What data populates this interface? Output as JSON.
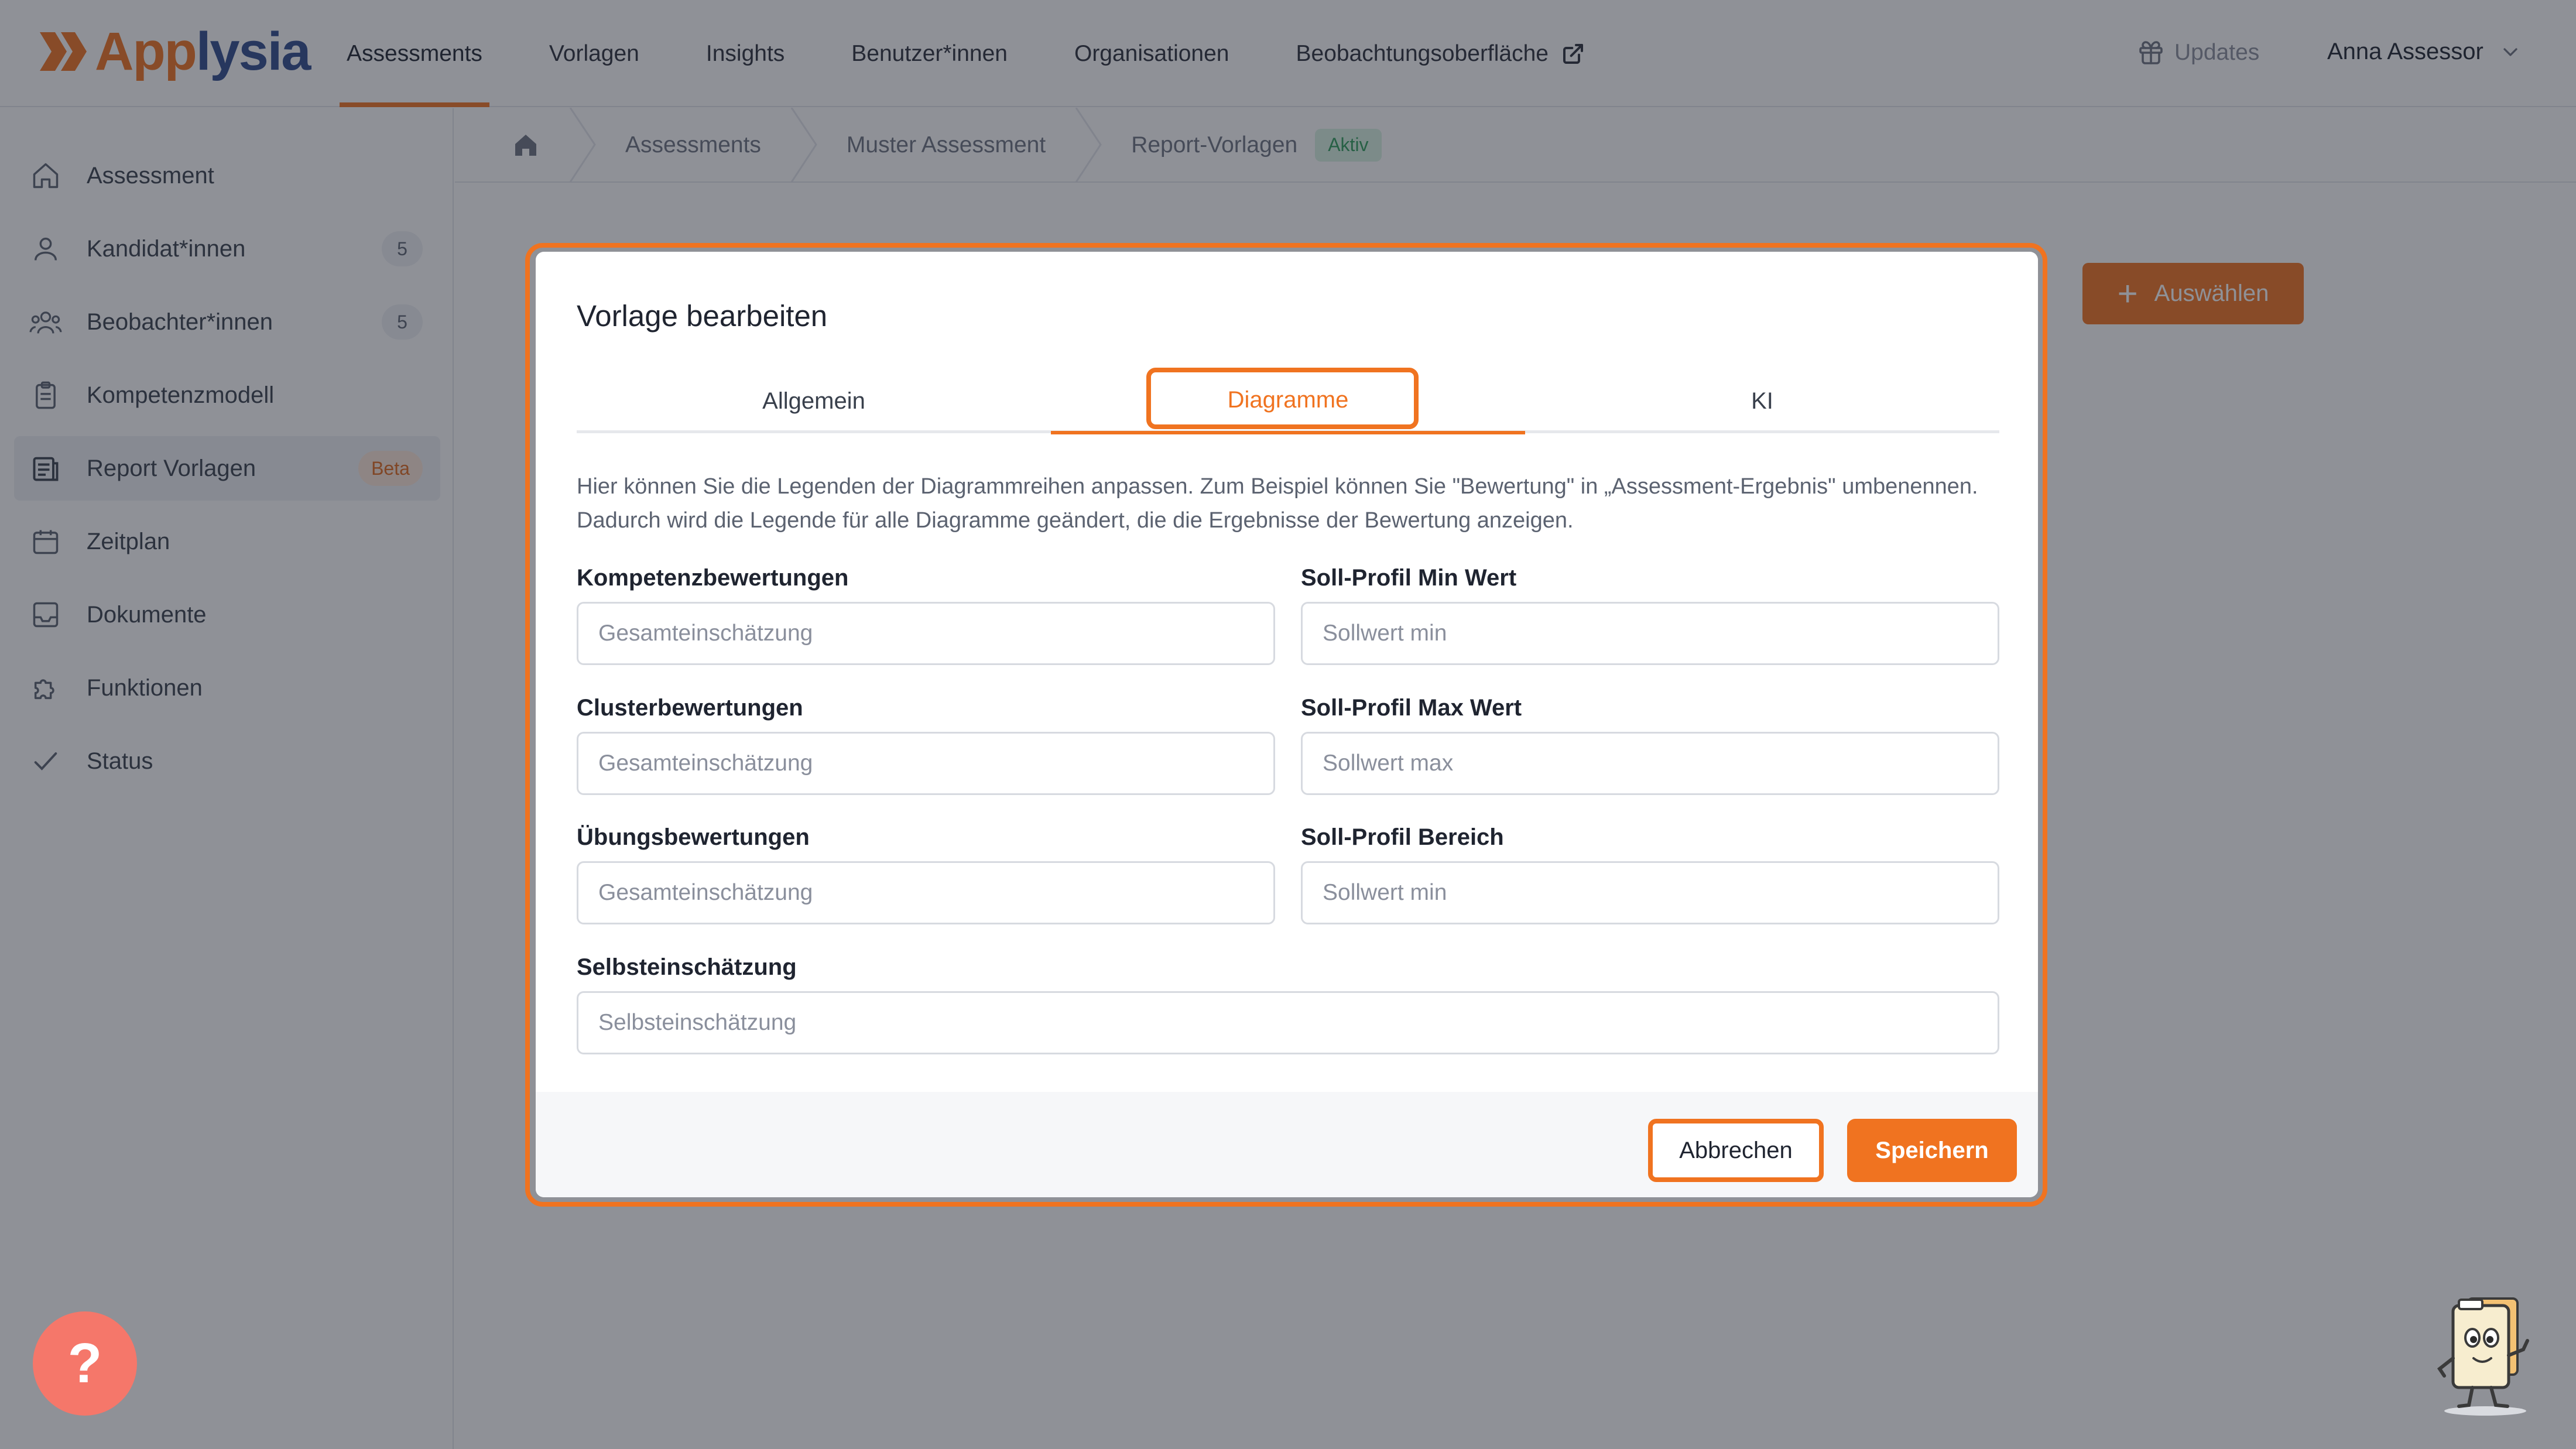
{
  "app": {
    "logo_text_a": "App",
    "logo_text_b": "lysia",
    "brand_color": "#f07320",
    "brand_color_secondary": "#2f4a8c"
  },
  "nav": {
    "items": [
      {
        "label": "Assessments",
        "active": true
      },
      {
        "label": "Vorlagen"
      },
      {
        "label": "Insights"
      },
      {
        "label": "Benutzer*innen"
      },
      {
        "label": "Organisationen"
      },
      {
        "label": "Beobachtungsoberfläche",
        "icon": "external-link-icon"
      }
    ],
    "updates_label": "Updates",
    "user_name": "Anna Assessor"
  },
  "sidebar": {
    "items": [
      {
        "label": "Assessment",
        "icon": "home-icon"
      },
      {
        "label": "Kandidat*innen",
        "icon": "user-icon",
        "badge": "5"
      },
      {
        "label": "Beobachter*innen",
        "icon": "users-icon",
        "badge": "5"
      },
      {
        "label": "Kompetenzmodell",
        "icon": "clipboard-icon"
      },
      {
        "label": "Report Vorlagen",
        "icon": "report-icon",
        "badge": "Beta",
        "active": true
      },
      {
        "label": "Zeitplan",
        "icon": "calendar-icon"
      },
      {
        "label": "Dokumente",
        "icon": "inbox-icon"
      },
      {
        "label": "Funktionen",
        "icon": "puzzle-icon"
      },
      {
        "label": "Status",
        "icon": "check-icon"
      }
    ]
  },
  "breadcrumb": {
    "items": [
      "Assessments",
      "Muster Assessment",
      "Report-Vorlagen"
    ],
    "status": "Aktiv"
  },
  "page": {
    "select_button": "Auswählen"
  },
  "modal": {
    "title": "Vorlage bearbeiten",
    "tabs": [
      {
        "label": "Allgemein"
      },
      {
        "label": "Diagramme",
        "active": true
      },
      {
        "label": "KI"
      }
    ],
    "intro": "Hier können Sie die Legenden der Diagrammreihen anpassen. Zum Beispiel können Sie \"Bewertung\" in „Assessment-Ergebnis\" umbenennen. Dadurch wird die Legende für alle Diagramme geändert, die die Ergebnisse der Bewertung anzeigen.",
    "fields": {
      "kompetenz": {
        "label": "Kompetenzbewertungen",
        "placeholder": "Gesamteinschätzung"
      },
      "cluster": {
        "label": "Clusterbewertungen",
        "placeholder": "Gesamteinschätzung"
      },
      "uebung": {
        "label": "Übungsbewertungen",
        "placeholder": "Gesamteinschätzung"
      },
      "selbst": {
        "label": "Selbsteinschätzung",
        "placeholder": "Selbsteinschätzung"
      },
      "soll_min": {
        "label": "Soll-Profil Min Wert",
        "placeholder": "Sollwert min"
      },
      "soll_max": {
        "label": "Soll-Profil Max Wert",
        "placeholder": "Sollwert max"
      },
      "soll_bereich": {
        "label": "Soll-Profil Bereich",
        "placeholder": "Sollwert min"
      }
    },
    "cancel": "Abbrechen",
    "save": "Speichern"
  },
  "help": {
    "label": "?"
  }
}
